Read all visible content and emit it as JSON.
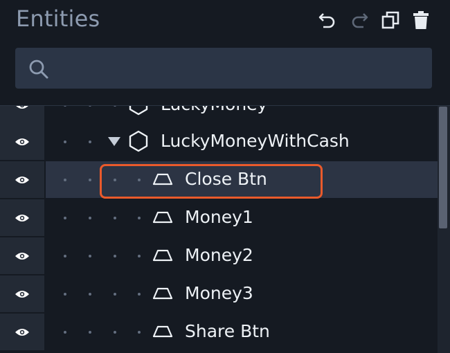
{
  "panel": {
    "title": "Entities"
  },
  "toolbar": {
    "undo_icon": "undo-icon",
    "redo_icon": "redo-icon",
    "duplicate_icon": "duplicate-icon",
    "delete_icon": "trash-icon"
  },
  "search": {
    "placeholder": "",
    "value": "",
    "icon": "search-icon"
  },
  "tree": {
    "rows": [
      {
        "label": "LuckyMoney",
        "icon": "hexagon-icon",
        "depth": 3,
        "expanded": null,
        "visible": true
      },
      {
        "label": "LuckyMoneyWithCash",
        "icon": "hexagon-icon",
        "depth": 2,
        "expanded": true,
        "visible": true
      },
      {
        "label": "Close Btn",
        "icon": "trapezoid-icon",
        "depth": 4,
        "selected": true,
        "visible": true
      },
      {
        "label": "Money1",
        "icon": "trapezoid-icon",
        "depth": 4,
        "visible": true
      },
      {
        "label": "Money2",
        "icon": "trapezoid-icon",
        "depth": 4,
        "visible": true
      },
      {
        "label": "Money3",
        "icon": "trapezoid-icon",
        "depth": 4,
        "visible": true
      },
      {
        "label": "Share Btn",
        "icon": "trapezoid-icon",
        "depth": 4,
        "visible": true
      }
    ]
  },
  "colors": {
    "background": "#151a22",
    "selected_row": "#2c3444",
    "highlight": "#ea5a2b",
    "title": "#8d9bb0"
  }
}
